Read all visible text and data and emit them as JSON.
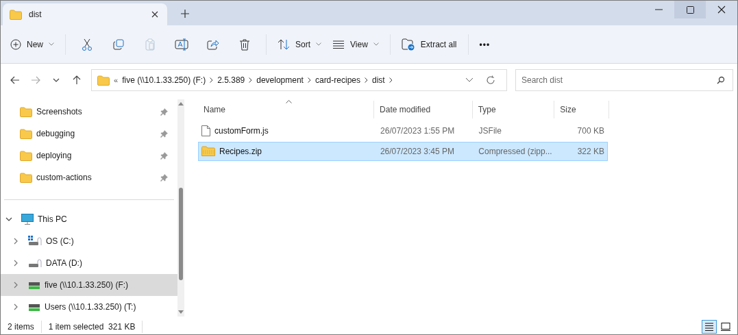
{
  "tabs": [
    {
      "title": "dist",
      "selected": true
    }
  ],
  "toolbar": [
    {
      "kind": "new",
      "label": "New",
      "disabled": false
    },
    {
      "kind": "sep"
    },
    {
      "kind": "cut",
      "disabled": false
    },
    {
      "kind": "copy",
      "disabled": false
    },
    {
      "kind": "paste",
      "disabled": true
    },
    {
      "kind": "rename",
      "disabled": false
    },
    {
      "kind": "share",
      "disabled": false
    },
    {
      "kind": "delete",
      "disabled": false
    },
    {
      "kind": "sep"
    },
    {
      "kind": "sort",
      "label": "Sort",
      "disabled": false
    },
    {
      "kind": "view",
      "label": "View",
      "disabled": false
    },
    {
      "kind": "sep"
    },
    {
      "kind": "extract",
      "label": "Extract all",
      "disabled": false
    },
    {
      "kind": "sep"
    },
    {
      "kind": "more",
      "label": "•••"
    }
  ],
  "nav": {
    "back_disabled": false,
    "forward_disabled": true
  },
  "breadcrumb": {
    "overflow": "«",
    "parts": [
      "five (\\\\10.1.33.250) (F:)",
      "2.5.389",
      "development",
      "card-recipes",
      "dist"
    ]
  },
  "search": {
    "placeholder": "Search dist"
  },
  "sidebar": {
    "pinned": [
      {
        "label": "Screenshots",
        "pinned": true
      },
      {
        "label": "debugging",
        "pinned": true
      },
      {
        "label": "deploying",
        "pinned": true
      },
      {
        "label": "custom-actions",
        "pinned": true
      }
    ],
    "tree": [
      {
        "label": "This PC",
        "kind": "pc",
        "expanded": true,
        "selected": false,
        "children": [
          {
            "label": "OS (C:)",
            "kind": "windows",
            "expanded": false,
            "selected": false
          },
          {
            "label": "DATA (D:)",
            "kind": "drive",
            "expanded": false,
            "selected": false
          },
          {
            "label": "five (\\\\10.1.33.250) (F:)",
            "kind": "network",
            "expanded": false,
            "selected": true
          },
          {
            "label": "Users (\\\\10.1.33.250) (T:)",
            "kind": "network",
            "expanded": false,
            "selected": false
          }
        ]
      }
    ]
  },
  "table": {
    "columns": [
      {
        "label": "Name",
        "sorted": true
      },
      {
        "label": "Date modified",
        "sorted": false
      },
      {
        "label": "Type",
        "sorted": false
      },
      {
        "label": "Size",
        "sorted": false
      }
    ],
    "rows": [
      {
        "kind": "file",
        "name": "customForm.js",
        "date": "26/07/2023 1:55 PM",
        "type": "JSFile",
        "size": "700 KB",
        "selected": false
      },
      {
        "kind": "zip",
        "name": "Recipes.zip",
        "date": "26/07/2023 3:45 PM",
        "type": "Compressed (zipp...",
        "size": "322 KB",
        "selected": true
      }
    ]
  },
  "status_bar": {
    "count": "2 items",
    "selection": "1 item selected  321 KB",
    "views": [
      {
        "kind": "details",
        "selected": true
      },
      {
        "kind": "tiles",
        "selected": false
      }
    ]
  }
}
